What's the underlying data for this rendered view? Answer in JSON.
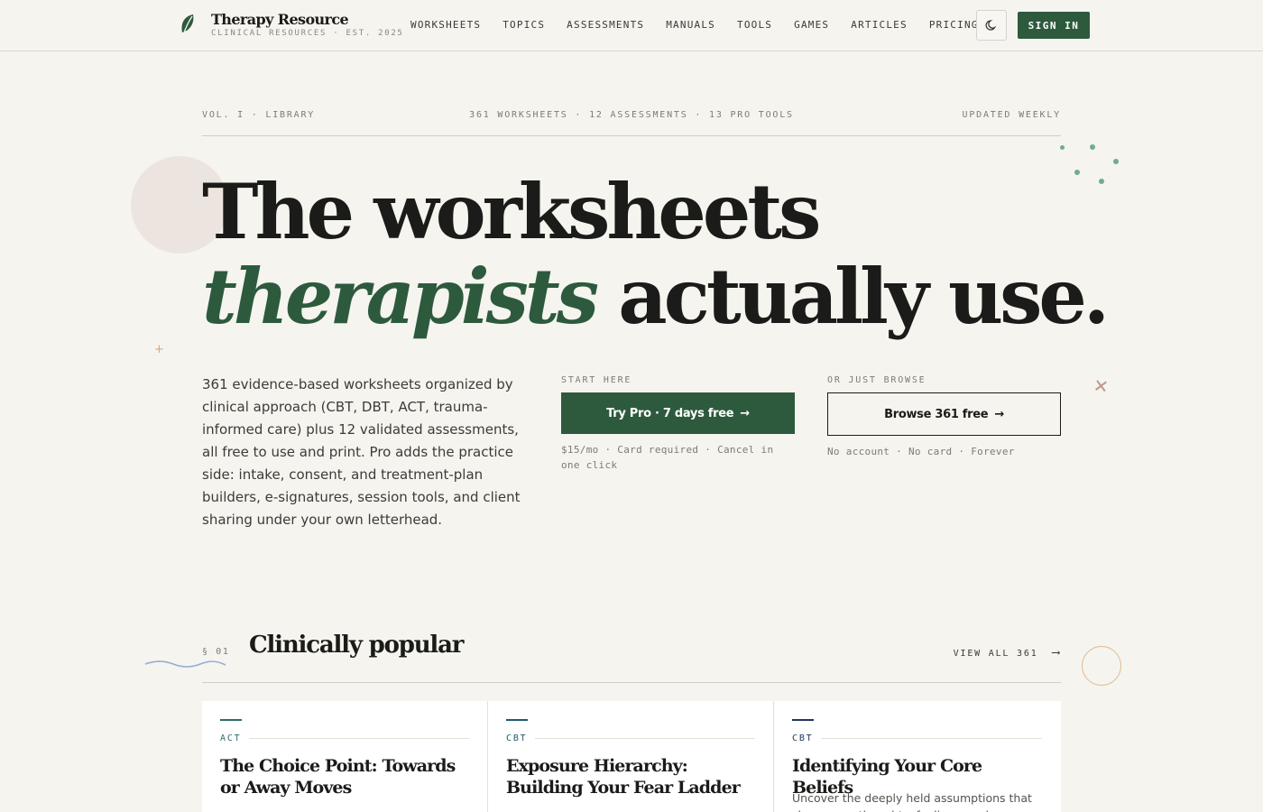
{
  "brand": {
    "name": "Therapy Resource",
    "tagline": "CLINICAL RESOURCES · EST. 2025",
    "icon": "leaf-icon",
    "color": "#2d5a3d"
  },
  "nav": {
    "items": [
      {
        "label": "WORKSHEETS"
      },
      {
        "label": "TOPICS"
      },
      {
        "label": "ASSESSMENTS"
      },
      {
        "label": "MANUALS"
      },
      {
        "label": "TOOLS"
      },
      {
        "label": "GAMES"
      },
      {
        "label": "ARTICLES"
      },
      {
        "label": "PRICING"
      }
    ],
    "theme_toggle_icon": "moon-icon",
    "signin_label": "SIGN IN"
  },
  "meta": {
    "left": "VOL. I · LIBRARY",
    "center": "361 WORKSHEETS · 12 ASSESSMENTS · 13 PRO TOOLS",
    "right": "UPDATED WEEKLY"
  },
  "hero": {
    "line1": "The worksheets",
    "line2_accent": "therapists",
    "line2_rest": " actually use.",
    "intro": "361 evidence-based worksheets organized by clinical approach (CBT, DBT, ACT, trauma-informed care) plus 12 validated assessments, all free to use and print. Pro adds the practice side: intake, consent, and treatment-plan builders, e-signatures, session tools, and client sharing under your own letterhead."
  },
  "cta": {
    "primary": {
      "eyebrow": "START HERE",
      "label": "Try Pro · 7 days free",
      "note": "$15/mo · Card required · Cancel in one click"
    },
    "secondary": {
      "eyebrow": "OR JUST BROWSE",
      "label": "Browse 361 free",
      "note": "No account · No card · Forever"
    }
  },
  "section": {
    "number": "§ 01",
    "title": "Clinically popular",
    "view_all": "VIEW ALL 361"
  },
  "cards": [
    {
      "tag": "ACT",
      "tag_color": "#2f6b6b",
      "title": "The Choice Point: Towards or Away Moves",
      "desc": ""
    },
    {
      "tag": "CBT",
      "tag_color": "#1f5a6e",
      "title": "Exposure Hierarchy: Building Your Fear Ladder",
      "desc": ""
    },
    {
      "tag": "CBT",
      "tag_color": "#23355e",
      "title": "Identifying Your Core Beliefs",
      "desc": "Uncover the deeply held assumptions that shape your thoughts, feelings, and behavior."
    }
  ]
}
